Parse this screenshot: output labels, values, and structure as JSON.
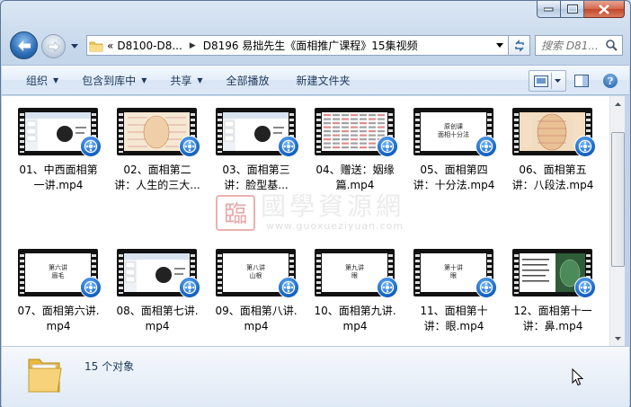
{
  "window": {
    "caption_buttons": [
      "minimize-icon",
      "maximize-icon",
      "close-icon"
    ]
  },
  "nav": {
    "back_icon": "back-arrow-icon",
    "forward_icon": "forward-arrow-icon",
    "breadcrumb_prefix": "«",
    "breadcrumb": [
      {
        "label": "D8100-D8..."
      },
      {
        "label": "D8196 易拙先生《面相推广课程》15集视频"
      }
    ]
  },
  "search": {
    "placeholder": "搜索 D81..."
  },
  "commands": {
    "organize": "组织",
    "include_in_library": "包含到库中",
    "share": "共享",
    "play_all": "全部播放",
    "new_folder": "新建文件夹"
  },
  "watermark": {
    "seal": "臨",
    "text": "國學資源網",
    "url": "www.guoxueziyuan.com"
  },
  "files": [
    {
      "line1": "01、中西面相第",
      "line2": "一讲.mp4",
      "thumb": "slides"
    },
    {
      "line1": "02、面相第二",
      "line2": "讲：人生的三大...",
      "thumb": "beige"
    },
    {
      "line1": "03、面相第三",
      "line2": "讲：脸型基...",
      "thumb": "slides"
    },
    {
      "line1": "04、赠送：姻缘",
      "line2": "篇.mp4",
      "thumb": "table"
    },
    {
      "line1": "05、面相第四",
      "line2": "讲：十分法.mp4",
      "thumb": "white",
      "slide": "原创课\n面相十分法"
    },
    {
      "line1": "06、面相第五",
      "line2": "讲：八段法.mp4",
      "thumb": "face"
    },
    {
      "line1": "07、面相第六讲.",
      "line2": "mp4",
      "thumb": "white",
      "slide": "第六讲\n眉毛"
    },
    {
      "line1": "08、面相第七讲.",
      "line2": "mp4",
      "thumb": "slides"
    },
    {
      "line1": "09、面相第八讲.",
      "line2": "mp4",
      "thumb": "white",
      "slide": "第八讲\n山根"
    },
    {
      "line1": "10、面相第九讲.",
      "line2": "mp4",
      "thumb": "white",
      "slide": "第九讲\n眼"
    },
    {
      "line1": "11、面相第十",
      "line2": "讲：眼.mp4",
      "thumb": "white",
      "slide": "第十讲\n眼"
    },
    {
      "line1": "12、面相第十一",
      "line2": "讲：鼻.mp4",
      "thumb": "green"
    }
  ],
  "details": {
    "count_text": "15 个对象"
  }
}
